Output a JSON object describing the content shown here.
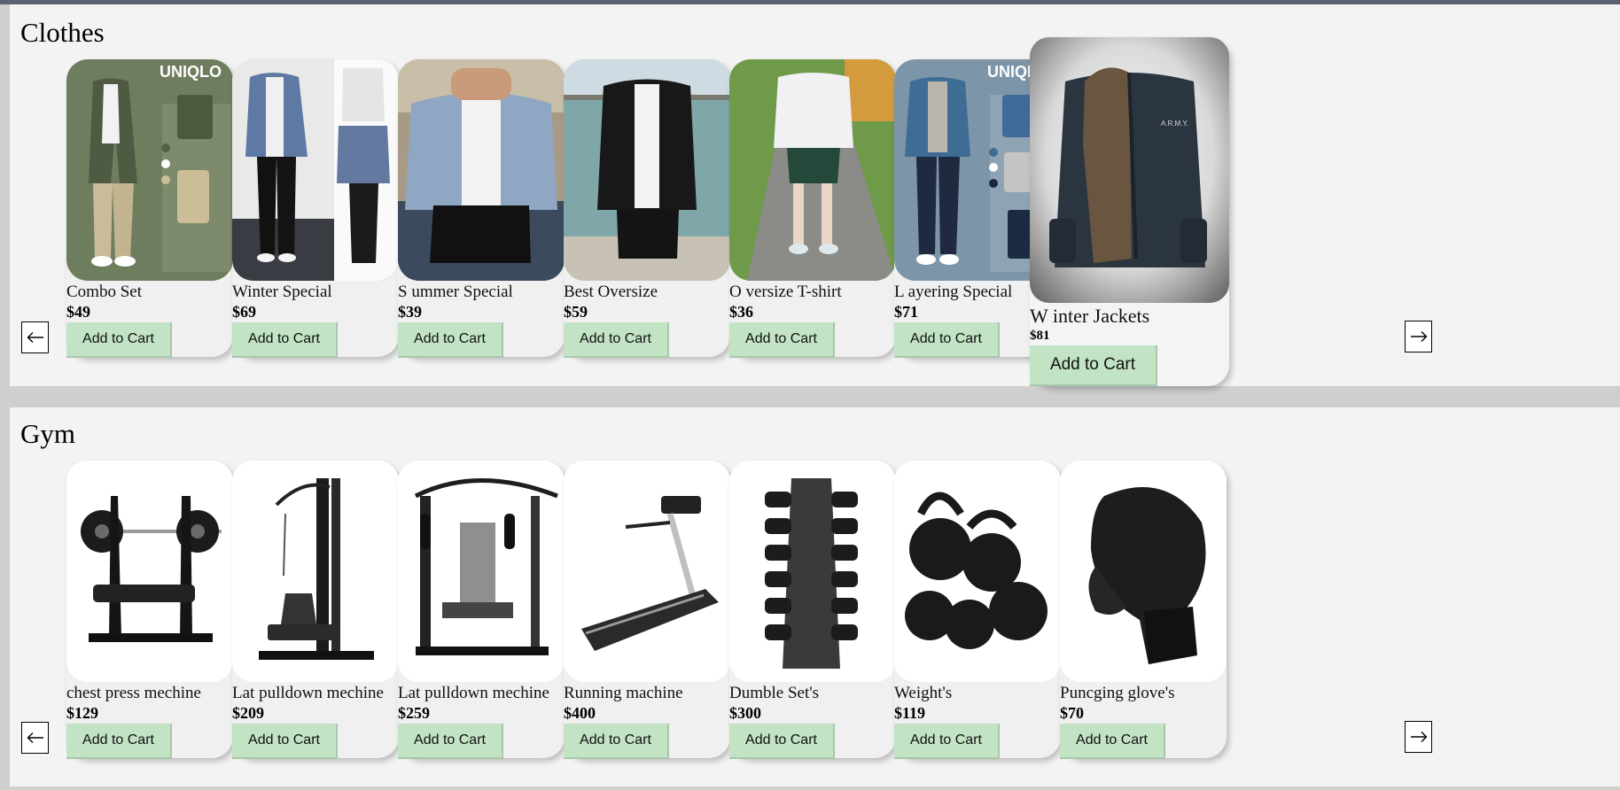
{
  "sections": {
    "clothes": {
      "title": "Clothes",
      "products": [
        {
          "name": "Combo Set",
          "price": "$49",
          "button": "Add to Cart"
        },
        {
          "name": "Winter Special",
          "price": "$69",
          "button": "Add to Cart"
        },
        {
          "name": "S ummer Special",
          "price": "$39",
          "button": "Add to Cart"
        },
        {
          "name": "Best Oversize",
          "price": "$59",
          "button": "Add to Cart"
        },
        {
          "name": "O versize T-shirt",
          "price": "$36",
          "button": "Add to Cart"
        },
        {
          "name": "L ayering Special",
          "price": "$71",
          "button": "Add to Cart"
        },
        {
          "name": "W inter Jackets",
          "price": "$81",
          "button": "Add to Cart"
        }
      ],
      "logo_text": "UNIQLO"
    },
    "gym": {
      "title": "Gym",
      "products": [
        {
          "name": "chest press mechine",
          "price": "$129",
          "button": "Add to Cart"
        },
        {
          "name": "Lat pulldown mechine",
          "price": "$209",
          "button": "Add to Cart"
        },
        {
          "name": "Lat pulldown mechine",
          "price": "$259",
          "button": "Add to Cart"
        },
        {
          "name": "Running machine",
          "price": "$400",
          "button": "Add to Cart"
        },
        {
          "name": "Dumble Set's",
          "price": "$300",
          "button": "Add to Cart"
        },
        {
          "name": "Weight's",
          "price": "$119",
          "button": "Add to Cart"
        },
        {
          "name": "Puncging glove's",
          "price": "$70",
          "button": "Add to Cart"
        }
      ]
    }
  },
  "icons": {
    "prev": "arrow-left-icon",
    "next": "arrow-right-icon"
  },
  "colors": {
    "button_bg": "#c2e3c4",
    "section_bg": "#f3f3f3",
    "page_bg": "#cfcfcf"
  }
}
